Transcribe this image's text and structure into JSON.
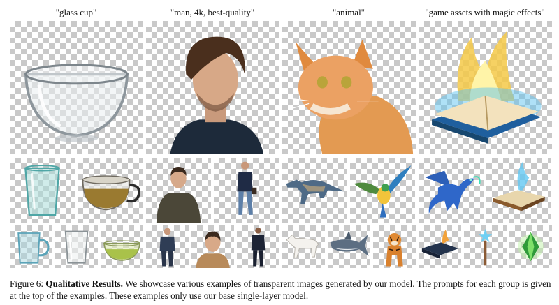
{
  "prompts": [
    "\"glass cup\"",
    "\"man, 4k, best-quality\"",
    "\"animal\"",
    "\"game assets with magic effects\""
  ],
  "caption": {
    "label": "Figure 6:",
    "title": "Qualitative Results.",
    "text": "We showcase various examples of transparent images generated by our model. The prompts for each group is given at the top of the examples. These examples only use our base single-layer model."
  }
}
